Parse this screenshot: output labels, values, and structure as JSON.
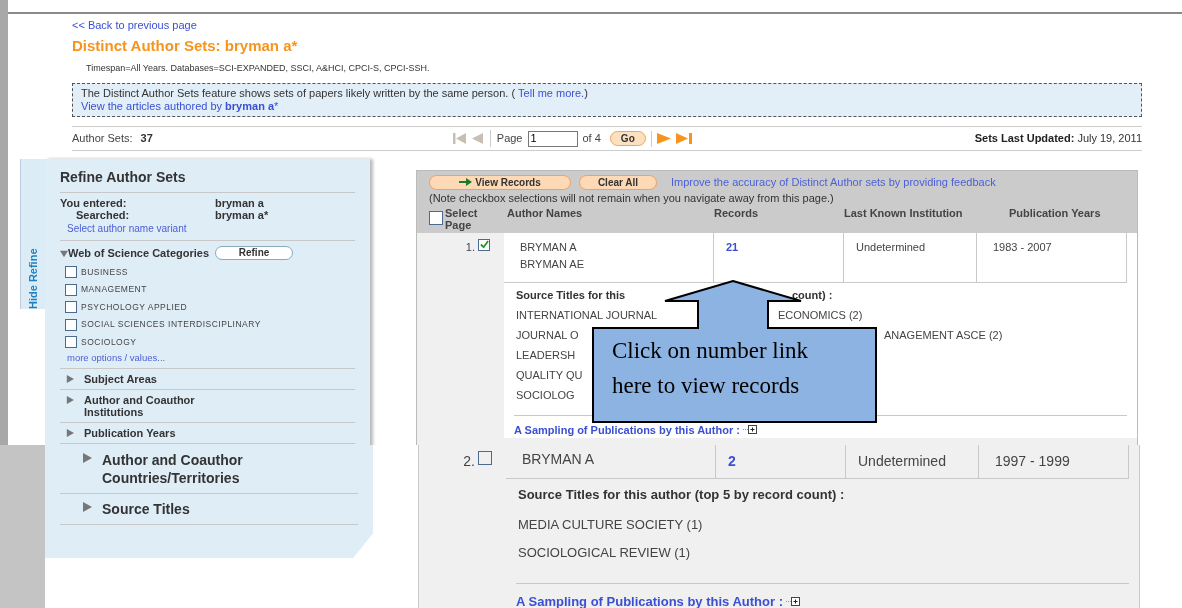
{
  "back_link": "<< Back to previous page",
  "title": "Distinct Author Sets: bryman a*",
  "timespan": "Timespan=All Years. Databases=SCI-EXPANDED, SSCI, A&HCI, CPCI-S, CPCI-SSH.",
  "info": {
    "text": "The Distinct Author Sets feature shows sets of papers likely written by the same person. (",
    "link": "Tell me more.",
    "close": ")",
    "line2": "View the articles authored by **bryman a***"
  },
  "author_sets": {
    "label": "Author Sets:",
    "count": "37"
  },
  "pager": {
    "page_label": "Page",
    "page_value": "1",
    "of": "of 4",
    "go": "Go"
  },
  "updated": {
    "label": "Sets Last Updated:",
    "value": "July 19, 2011"
  },
  "refine": {
    "tab_label": "Hide Refine",
    "title": "Refine Author Sets",
    "entered_label": "You entered:",
    "entered_value": "bryman a",
    "searched_label": "Searched:",
    "searched_value": "bryman a*",
    "variant_link": "Select author name variant",
    "categories": {
      "label": "Web of Science Categories",
      "expanded": true,
      "button": "Refine",
      "items": [
        {
          "label": "BUSINESS",
          "checked": false
        },
        {
          "label": "MANAGEMENT",
          "checked": false
        },
        {
          "label": "PSYCHOLOGY APPLIED",
          "checked": false
        },
        {
          "label": "SOCIAL SCIENCES INTERDISCIPLINARY",
          "checked": false
        },
        {
          "label": "SOCIOLOGY",
          "checked": false
        }
      ],
      "more": "more options / values..."
    },
    "sections": [
      {
        "label": "Subject Areas",
        "expanded": false
      },
      {
        "label": "Author and Coauthor Institutions",
        "expanded": false
      },
      {
        "label": "Publication Years",
        "expanded": false
      }
    ]
  },
  "refine_continued": {
    "sections": [
      {
        "label": "Author and Coauthor Countries/Territories",
        "expanded": false
      },
      {
        "label": "Source Titles",
        "expanded": false
      }
    ]
  },
  "results": {
    "view_button": "View Records",
    "clear_button": "Clear All",
    "feedback_link": "Improve the accuracy of Distinct Author sets by providing feedback",
    "note": "(Note checkbox selections will not remain when you navigate away from this page.)",
    "select_all": {
      "label": "Select Page",
      "checked": false
    },
    "columns": [
      "Author Names",
      "Records",
      "Last Known Institution",
      "Publication Years"
    ],
    "rows": [
      {
        "number": "1.",
        "checked": true,
        "names": [
          "BRYMAN A",
          "BRYMAN AE"
        ],
        "records": "21",
        "institution": "Undetermined",
        "years": "1983 - 2007",
        "source_heading": {
          "left": "Source Titles for this",
          "right": "count) :"
        },
        "titles": [
          {
            "left": "INTERNATIONAL JOURNAL",
            "right": "ECONOMICS (2)"
          },
          {
            "left": "JOURNAL O",
            "right": "ANAGEMENT ASCE (2)"
          },
          {
            "left": "LEADERSH"
          },
          {
            "left": "QUALITY QU"
          },
          {
            "left": "SOCIOLOG"
          }
        ],
        "sampling": "A Sampling of Publications by this Author :"
      }
    ]
  },
  "results_continued": {
    "rows": [
      {
        "number": "2.",
        "checked": false,
        "names": [
          "BRYMAN A"
        ],
        "records": "2",
        "institution": "Undetermined",
        "years": "1997 - 1999",
        "source_heading": {
          "left": "Source Titles for this author (top 5 by record count) :"
        },
        "titles": [
          {
            "left": "MEDIA CULTURE SOCIETY (1)"
          },
          {
            "left": "SOCIOLOGICAL REVIEW (1)"
          }
        ],
        "sampling": "A Sampling of Publications by this Author :"
      }
    ]
  },
  "callout": {
    "text": "Click on number link here to view records"
  }
}
